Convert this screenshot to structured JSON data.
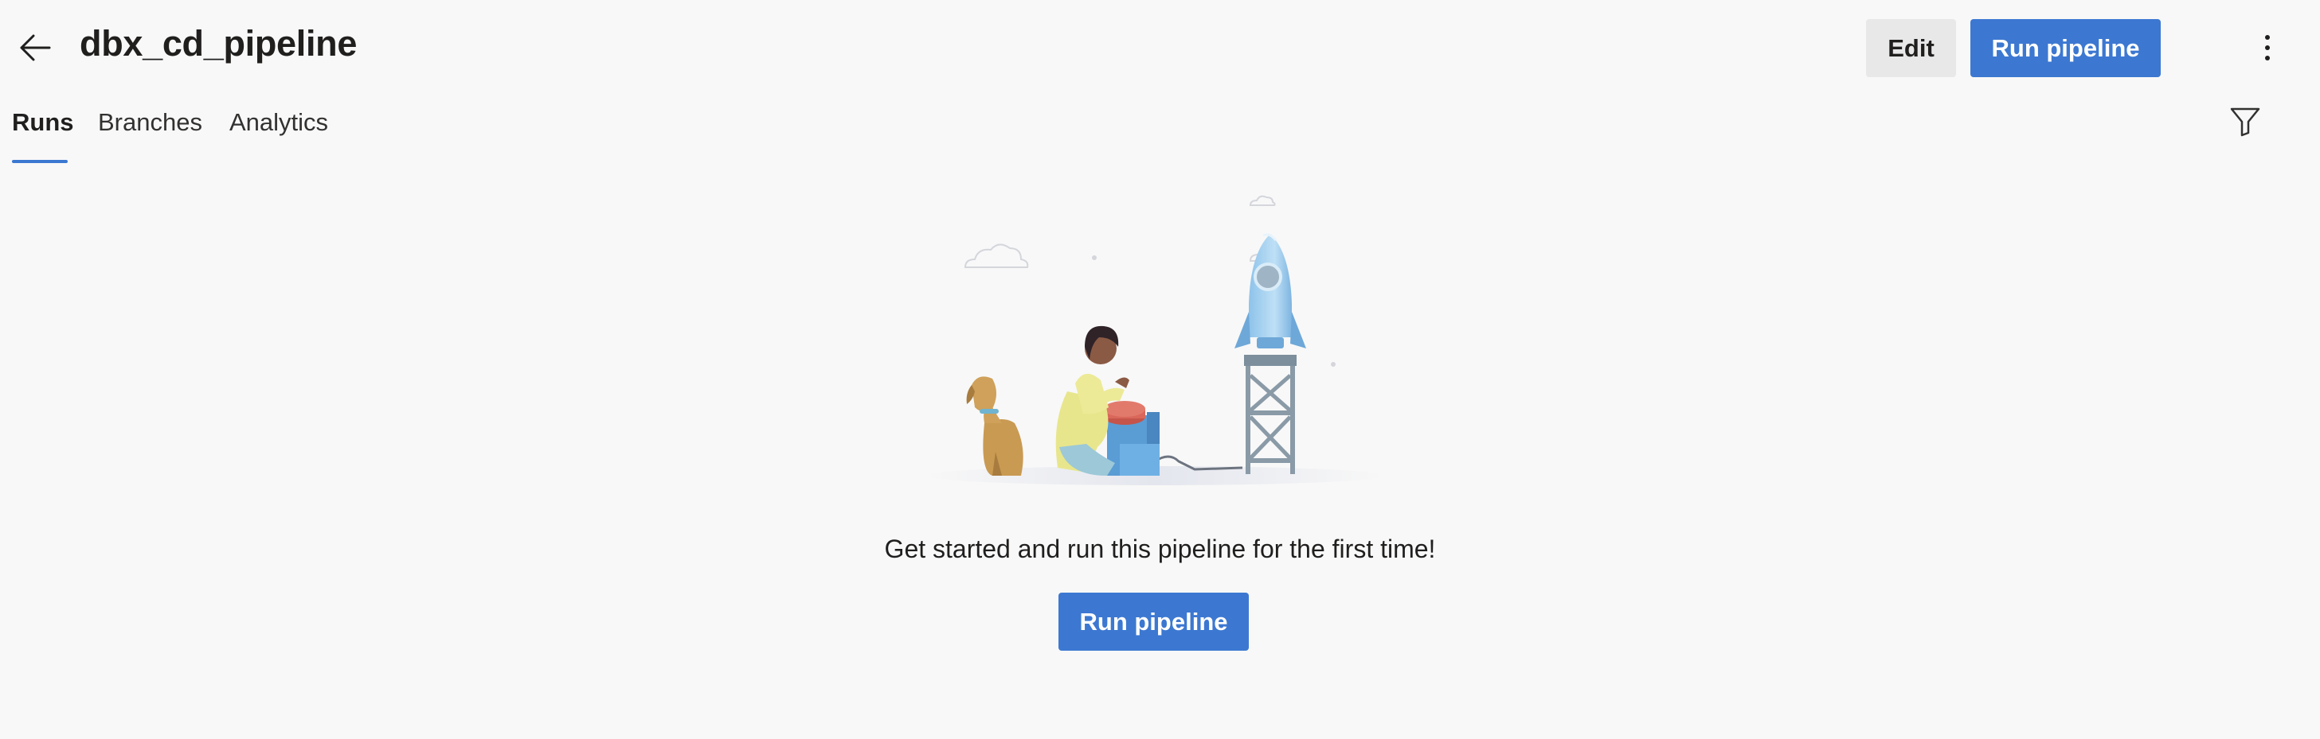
{
  "header": {
    "back_icon": "arrow-left-icon",
    "title": "dbx_cd_pipeline",
    "edit_label": "Edit",
    "run_label": "Run pipeline",
    "more_icon": "more-vertical-icon"
  },
  "tabs": [
    {
      "label": "Runs",
      "active": true
    },
    {
      "label": "Branches",
      "active": false
    },
    {
      "label": "Analytics",
      "active": false
    }
  ],
  "filter_icon": "filter-icon",
  "empty_state": {
    "illustration": "rocket-launch-illustration",
    "message": "Get started and run this pipeline for the first time!",
    "button_label": "Run pipeline"
  },
  "colors": {
    "accent": "#3c78d1",
    "background": "#f8f8f8",
    "secondary_button": "#e8e8e8"
  }
}
